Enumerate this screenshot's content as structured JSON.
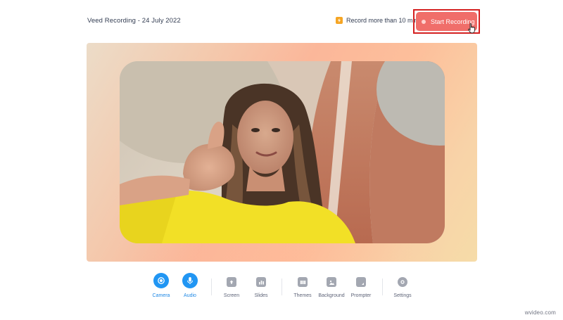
{
  "header": {
    "recording_title": "Veed Recording - 24 July 2022",
    "upsell_text": "Record more than 10 min",
    "start_recording_label": "Start Recording"
  },
  "toolbar": {
    "items": [
      {
        "label": "Camera",
        "active": true,
        "icon": "camera-icon"
      },
      {
        "label": "Audio",
        "active": true,
        "icon": "microphone-icon"
      },
      {
        "label": "Screen",
        "active": false,
        "icon": "screen-share-icon"
      },
      {
        "label": "Slides",
        "active": false,
        "icon": "slides-icon"
      },
      {
        "label": "Themes",
        "active": false,
        "icon": "themes-icon"
      },
      {
        "label": "Background",
        "active": false,
        "icon": "background-image-icon"
      },
      {
        "label": "Prompter",
        "active": false,
        "icon": "prompter-icon"
      },
      {
        "label": "Settings",
        "active": false,
        "icon": "gear-icon"
      }
    ]
  },
  "watermark": "wvideo.com",
  "colors": {
    "accent_blue": "#2196f3",
    "record_button": "#f06e6a",
    "highlight_border": "#d42020",
    "upsell_badge": "#f5a524"
  }
}
